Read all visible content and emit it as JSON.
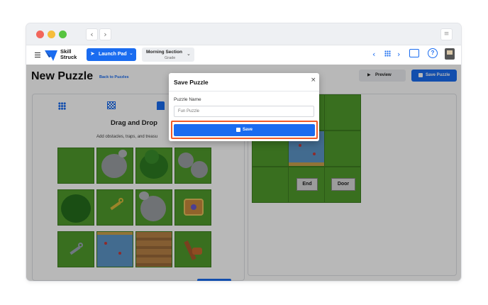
{
  "app": {
    "logo_line1": "Skill",
    "logo_line2": "Struck",
    "launch_pad": "Launch Pad",
    "section_name": "Morning Section",
    "section_sub": "Grade"
  },
  "page": {
    "title": "New Puzzle",
    "back_link": "Back to Puzzles",
    "preview_label": "Preview",
    "save_puzzle_label": "Save Puzzle"
  },
  "left_panel": {
    "heading": "Drag and Drop",
    "description": "Add obstacles, traps, and treasu",
    "tiles": [
      "grass",
      "rock",
      "bush",
      "rock",
      "bush",
      "key",
      "rock",
      "treasure-chest",
      "key",
      "water",
      "bridge",
      "trap"
    ]
  },
  "board": {
    "end_label": "End",
    "door_label": "Door"
  },
  "modal": {
    "title": "Save Puzzle",
    "field_label": "Puzzle Name",
    "field_value": "Fun Puzzle",
    "save_label": "Save",
    "close_glyph": "×"
  },
  "icons": {
    "menu": "hamburger-menu-icon",
    "launch": "rocket-icon",
    "grid": "grid-icon",
    "flag": "checkered-flag-icon",
    "save": "floppy-disk-icon",
    "play": "play-icon",
    "help": "help-icon",
    "presentation": "presentation-icon"
  },
  "colors": {
    "accent": "#1a6cf0",
    "highlight": "#f05a28",
    "grass": "#4f9a2c"
  }
}
